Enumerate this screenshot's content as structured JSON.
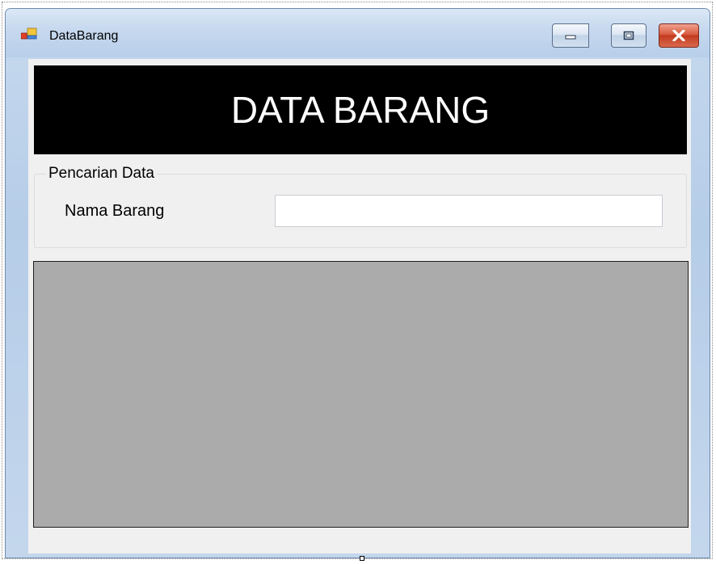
{
  "window": {
    "title": "DataBarang",
    "icon": "winforms-form-icon",
    "controls": [
      "minimize-icon",
      "maximize-icon",
      "close-icon"
    ]
  },
  "banner": {
    "text": "DATA BARANG"
  },
  "search_group": {
    "legend": "Pencarian Data",
    "field_label": "Nama Barang",
    "field_value": ""
  },
  "grid": {
    "columns": [],
    "rows": []
  },
  "colors": {
    "banner_bg": "#000000",
    "banner_text": "#ffffff",
    "client_bg": "#f0f0f0",
    "grid_bg": "#ababab",
    "close_button": "#c9452a"
  }
}
